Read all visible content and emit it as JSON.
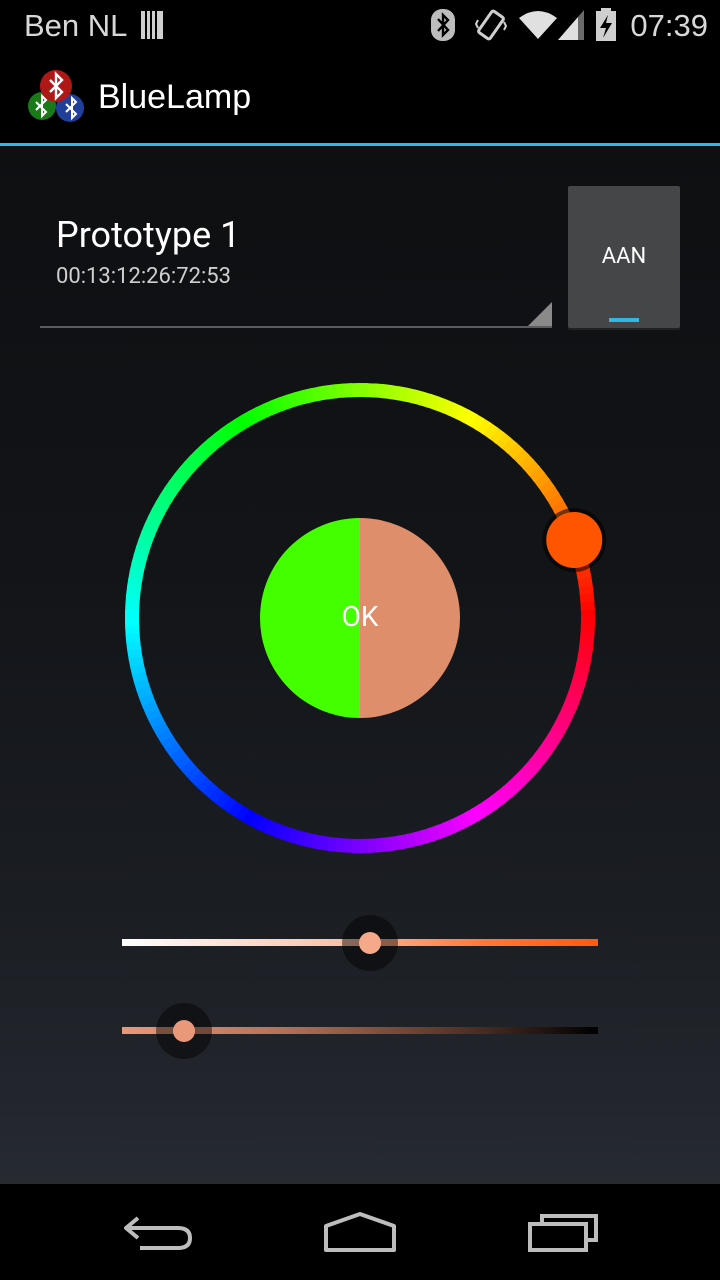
{
  "status_bar": {
    "carrier": "Ben NL",
    "time": "07:39",
    "icons": [
      "sim-card-icon",
      "bluetooth-icon",
      "vibrate-icon",
      "wifi-icon",
      "signal-icon",
      "battery-charging-icon"
    ]
  },
  "action_bar": {
    "title": "BlueLamp",
    "logo_icon": "bluetooth-logo-icon"
  },
  "device": {
    "name": "Prototype 1",
    "address": "00:13:12:26:72:53"
  },
  "power_toggle": {
    "label": "AAN",
    "accent_color": "#33b5e5"
  },
  "color_picker": {
    "ok_label": "OK",
    "previous_color": "#44ff00",
    "selected_color": "#df8e6b",
    "hue_handle_color": "#ff5500"
  },
  "saturation_slider": {
    "value": 0.52,
    "thumb_color": "#f4a98a"
  },
  "value_slider": {
    "value": 0.13,
    "thumb_color": "#e9997a"
  },
  "navigation": {
    "icons": [
      "back-icon",
      "home-icon",
      "recents-icon"
    ]
  }
}
